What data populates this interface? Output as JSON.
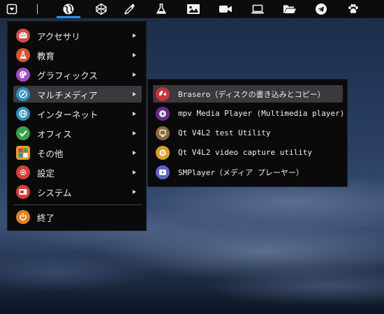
{
  "panel": {
    "buttons": [
      {
        "name": "menu-button",
        "icon": "menu-triangle-icon"
      },
      {
        "name": "browser-button",
        "icon": "globe-icon"
      },
      {
        "name": "codepen-button",
        "icon": "codepen-icon"
      },
      {
        "name": "color-picker-button",
        "icon": "eyedropper-icon"
      },
      {
        "name": "science-button",
        "icon": "flask-icon"
      },
      {
        "name": "image-viewer-button",
        "icon": "image-icon"
      },
      {
        "name": "video-button",
        "icon": "video-camera-icon"
      },
      {
        "name": "terminal-button",
        "icon": "laptop-icon"
      },
      {
        "name": "file-manager-button",
        "icon": "folder-open-icon"
      },
      {
        "name": "telegram-button",
        "icon": "telegram-icon"
      },
      {
        "name": "pets-button",
        "icon": "paw-icon"
      }
    ],
    "accent": "#2f8ee0"
  },
  "menu": {
    "items": [
      {
        "label": "アクセサリ",
        "icon": "accessories-icon",
        "color": "#d24b4b",
        "has_submenu": true
      },
      {
        "label": "教育",
        "icon": "education-flask-icon",
        "color": "#d9532c",
        "has_submenu": true
      },
      {
        "label": "グラフィックス",
        "icon": "graphics-palette-icon",
        "color": "#a54cc0",
        "has_submenu": true
      },
      {
        "label": "マルチメディア",
        "icon": "multimedia-icon",
        "color": "#2f8fb8",
        "has_submenu": true
      },
      {
        "label": "インターネット",
        "icon": "internet-globe-icon",
        "color": "#2f8fb8",
        "has_submenu": true
      },
      {
        "label": "オフィス",
        "icon": "office-check-icon",
        "color": "#3aa04a",
        "has_submenu": true
      },
      {
        "label": "その他",
        "icon": "other-grid-icon",
        "color": "#e0a02a",
        "has_submenu": true
      },
      {
        "label": "設定",
        "icon": "settings-gear-icon",
        "color": "#d2403a",
        "has_submenu": true
      },
      {
        "label": "システム",
        "icon": "system-icon",
        "color": "#d2403a",
        "has_submenu": true
      }
    ],
    "exit_label": "終了",
    "exit_icon": "exit-power-icon",
    "exit_color": "#e0821e",
    "active_index": 3
  },
  "submenu": {
    "items": [
      {
        "label": "Brasero（ディスクの書き込みとコピー）",
        "icon": "brasero-icon",
        "color": "#c8323c"
      },
      {
        "label": "mpv Media Player (Multimedia player)",
        "icon": "mpv-icon",
        "color": "#6b2a8c"
      },
      {
        "label": "Qt V4L2 test Utility",
        "icon": "qt-v4l2-test-icon",
        "color": "#8a6a3c"
      },
      {
        "label": "Qt V4L2 video capture utility",
        "icon": "qt-v4l2-capture-icon",
        "color": "#d9a12a"
      },
      {
        "label": "SMPlayer（メディア プレーヤー）",
        "icon": "smplayer-icon",
        "color": "#5b64c8"
      }
    ],
    "active_index": 0
  }
}
